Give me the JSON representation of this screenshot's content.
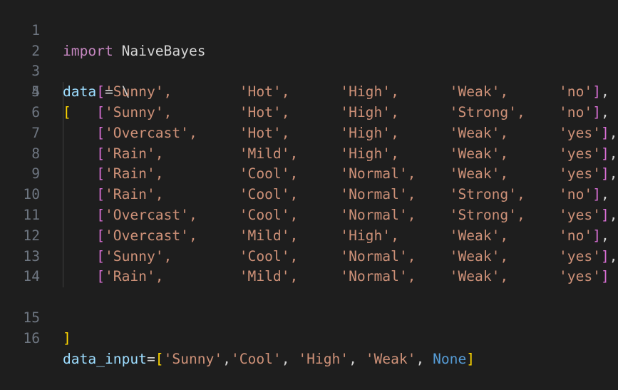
{
  "editor": {
    "line_numbers": [
      "1",
      "2",
      "3",
      "4",
      "5",
      "6",
      "7",
      "8",
      "9",
      "10",
      "11",
      "12",
      "13",
      "14",
      "15",
      "16"
    ],
    "line1": {
      "import_kw": "import",
      "module": " NaiveBayes"
    },
    "line3": {
      "var": "data",
      "rest": " = \\"
    },
    "line4": {
      "open": "["
    },
    "rows": [
      {
        "open": "[",
        "c1": "'Sunny',",
        "s1": "        ",
        "c2": "'Hot',",
        "s2": "      ",
        "c3": "'High',",
        "s3": "      ",
        "c4": "'Weak',",
        "s4": "      ",
        "c5": "'no'",
        "close": "]",
        "tail": ","
      },
      {
        "open": "[",
        "c1": "'Sunny',",
        "s1": "        ",
        "c2": "'Hot',",
        "s2": "      ",
        "c3": "'High',",
        "s3": "      ",
        "c4": "'Strong',",
        "s4": "    ",
        "c5": "'no'",
        "close": "]",
        "tail": ","
      },
      {
        "open": "[",
        "c1": "'Overcast',",
        "s1": "     ",
        "c2": "'Hot',",
        "s2": "      ",
        "c3": "'High',",
        "s3": "      ",
        "c4": "'Weak',",
        "s4": "      ",
        "c5": "'yes'",
        "close": "]",
        "tail": ","
      },
      {
        "open": "[",
        "c1": "'Rain',",
        "s1": "         ",
        "c2": "'Mild',",
        "s2": "     ",
        "c3": "'High',",
        "s3": "      ",
        "c4": "'Weak',",
        "s4": "      ",
        "c5": "'yes'",
        "close": "]",
        "tail": ","
      },
      {
        "open": "[",
        "c1": "'Rain',",
        "s1": "         ",
        "c2": "'Cool',",
        "s2": "     ",
        "c3": "'Normal',",
        "s3": "    ",
        "c4": "'Weak',",
        "s4": "      ",
        "c5": "'yes'",
        "close": "]",
        "tail": ","
      },
      {
        "open": "[",
        "c1": "'Rain',",
        "s1": "         ",
        "c2": "'Cool',",
        "s2": "     ",
        "c3": "'Normal',",
        "s3": "    ",
        "c4": "'Strong',",
        "s4": "    ",
        "c5": "'no'",
        "close": "]",
        "tail": ","
      },
      {
        "open": "[",
        "c1": "'Overcast',",
        "s1": "     ",
        "c2": "'Cool',",
        "s2": "     ",
        "c3": "'Normal',",
        "s3": "    ",
        "c4": "'Strong',",
        "s4": "    ",
        "c5": "'yes'",
        "close": "]",
        "tail": ","
      },
      {
        "open": "[",
        "c1": "'Overcast',",
        "s1": "     ",
        "c2": "'Mild',",
        "s2": "     ",
        "c3": "'High',",
        "s3": "      ",
        "c4": "'Weak',",
        "s4": "      ",
        "c5": "'no'",
        "close": "]",
        "tail": ","
      },
      {
        "open": "[",
        "c1": "'Sunny',",
        "s1": "        ",
        "c2": "'Cool',",
        "s2": "     ",
        "c3": "'Normal',",
        "s3": "    ",
        "c4": "'Weak',",
        "s4": "      ",
        "c5": "'yes'",
        "close": "]",
        "tail": ","
      },
      {
        "open": "[",
        "c1": "'Rain',",
        "s1": "         ",
        "c2": "'Mild',",
        "s2": "     ",
        "c3": "'Normal',",
        "s3": "    ",
        "c4": "'Weak',",
        "s4": "      ",
        "c5": "'yes'",
        "close": "]",
        "tail": ""
      }
    ],
    "line15": {
      "close": "]"
    },
    "line16": {
      "var": "data_input",
      "eq": "=",
      "open": "[",
      "v1": "'Sunny'",
      "sep1": ",",
      "v2": "'Cool'",
      "sep2": ", ",
      "v3": "'High'",
      "sep3": ", ",
      "v4": "'Weak'",
      "sep4": ", ",
      "none": "None",
      "close": "]"
    }
  }
}
